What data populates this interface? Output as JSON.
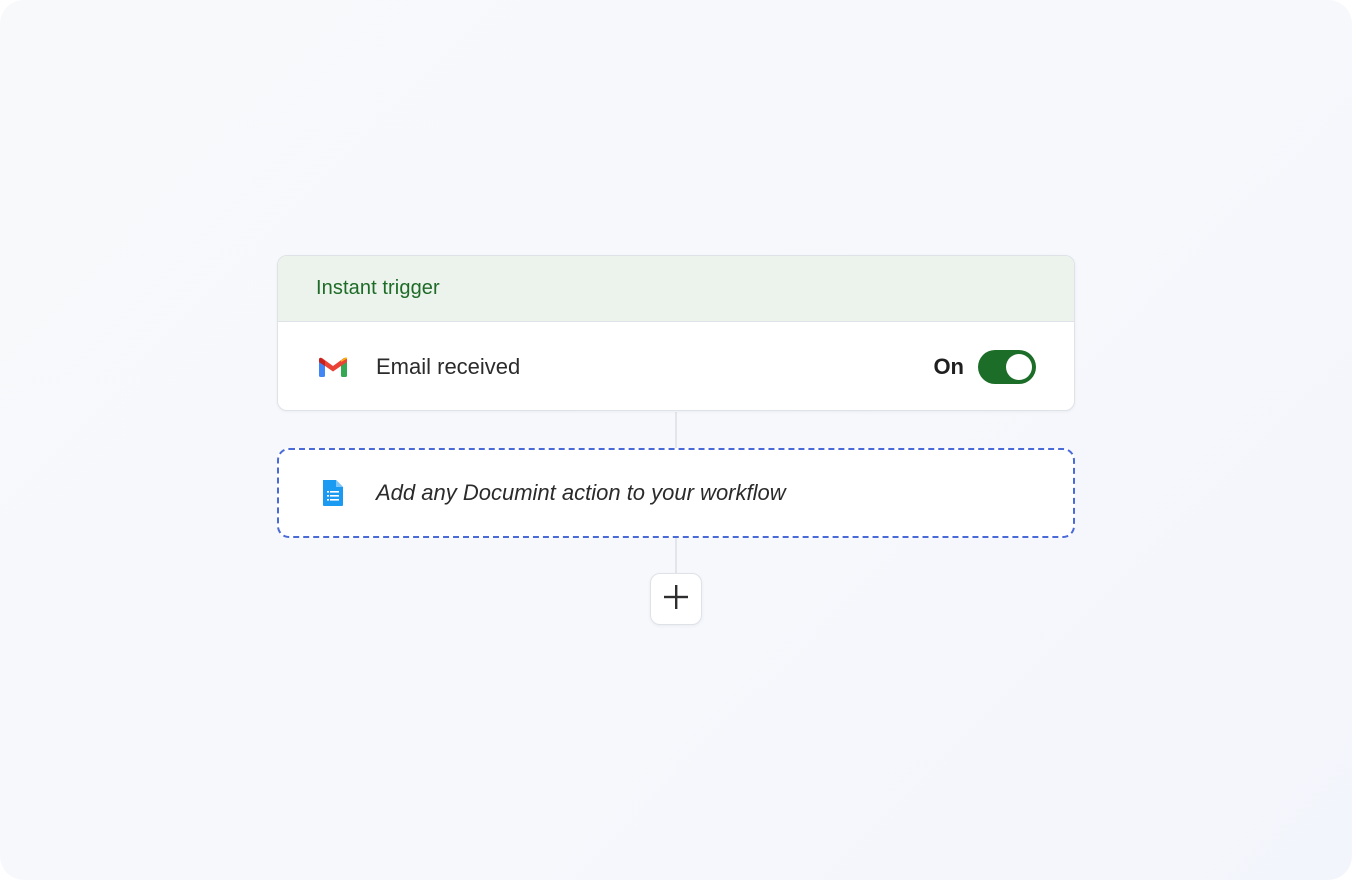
{
  "trigger": {
    "header_title": "Instant trigger",
    "app_icon": "gmail-icon",
    "event_label": "Email received",
    "toggle_label": "On",
    "toggle_on": true,
    "accent_color": "#1c6d28",
    "header_bg": "#ecf3ec"
  },
  "action_placeholder": {
    "icon": "document-icon",
    "label": "Add any Documint action to your workflow",
    "border_color": "#4a6ad8"
  },
  "add_step": {
    "icon": "plus-icon"
  }
}
